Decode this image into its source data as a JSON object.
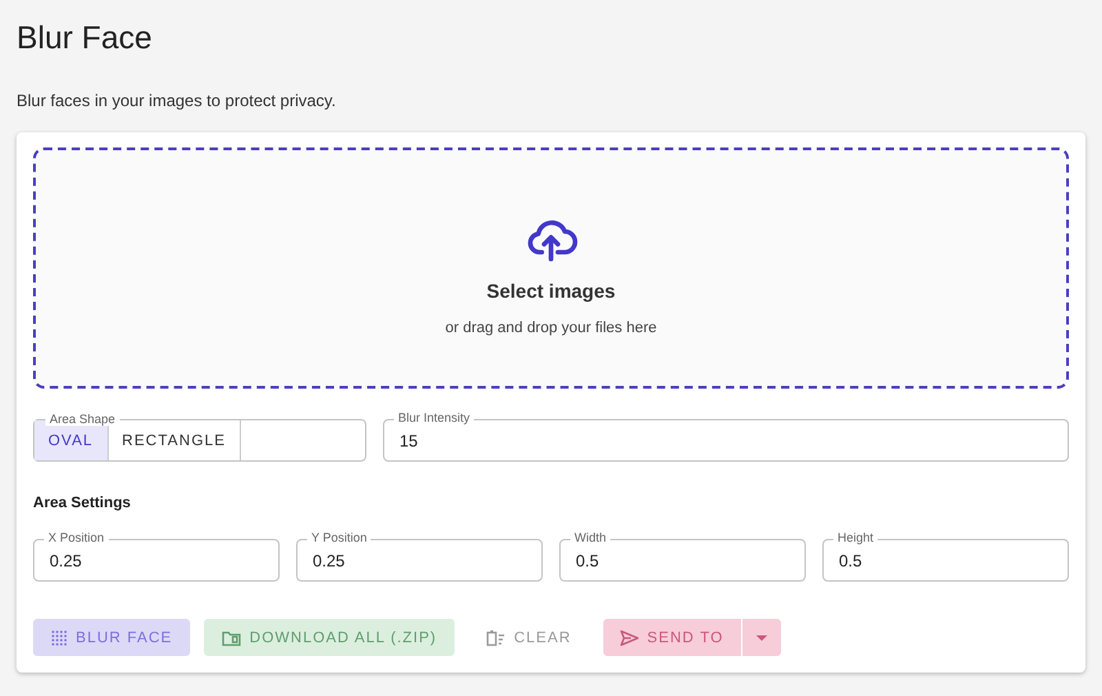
{
  "page": {
    "title": "Blur Face",
    "subtitle": "Blur faces in your images to protect privacy."
  },
  "dropzone": {
    "title": "Select images",
    "hint": "or drag and drop your files here"
  },
  "area_shape": {
    "label": "Area Shape",
    "options": [
      {
        "label": "OVAL",
        "selected": true
      },
      {
        "label": "RECTANGLE",
        "selected": false
      }
    ]
  },
  "blur_intensity": {
    "label": "Blur Intensity",
    "value": "15"
  },
  "area_settings": {
    "heading": "Area Settings",
    "fields": [
      {
        "label": "X Position",
        "value": "0.25"
      },
      {
        "label": "Y Position",
        "value": "0.25"
      },
      {
        "label": "Width",
        "value": "0.5"
      },
      {
        "label": "Height",
        "value": "0.5"
      }
    ]
  },
  "buttons": [
    {
      "kind": "primary",
      "label": "BLUR FACE",
      "disabled": true
    },
    {
      "kind": "success",
      "label": "DOWNLOAD ALL (.ZIP)",
      "disabled": true
    },
    {
      "kind": "text",
      "label": "CLEAR",
      "disabled": true
    },
    {
      "kind": "split",
      "label": "SEND TO",
      "disabled": true
    }
  ]
}
